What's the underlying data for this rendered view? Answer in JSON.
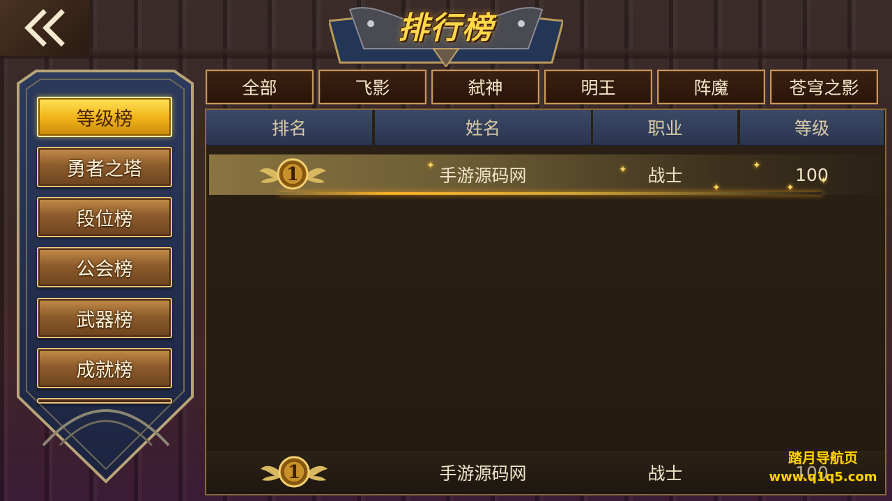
{
  "title": "排行榜",
  "side_menu": [
    {
      "label": "等级榜",
      "active": true
    },
    {
      "label": "勇者之塔",
      "active": false
    },
    {
      "label": "段位榜",
      "active": false
    },
    {
      "label": "公会榜",
      "active": false
    },
    {
      "label": "武器榜",
      "active": false
    },
    {
      "label": "成就榜",
      "active": false
    }
  ],
  "tabs": [
    "全部",
    "飞影",
    "弑神",
    "明王",
    "阵魔",
    "苍穹之影"
  ],
  "columns": [
    "排名",
    "姓名",
    "职业",
    "等级"
  ],
  "rows": [
    {
      "rank": "1",
      "name": "手游源码网",
      "class": "战士",
      "level": "100"
    }
  ],
  "self_row": {
    "rank": "1",
    "name": "手游源码网",
    "class": "战士",
    "level": "100"
  },
  "watermark": {
    "line1": "踏月导航页",
    "line2": "www.q1q5.com"
  },
  "colors": {
    "gold": "#ffd84a",
    "header_blue": "#3c4a66",
    "tab_border": "#c8995a"
  },
  "icons": {
    "back": "double-chevron-left-icon",
    "rank_badge": "winged-medal-icon"
  }
}
